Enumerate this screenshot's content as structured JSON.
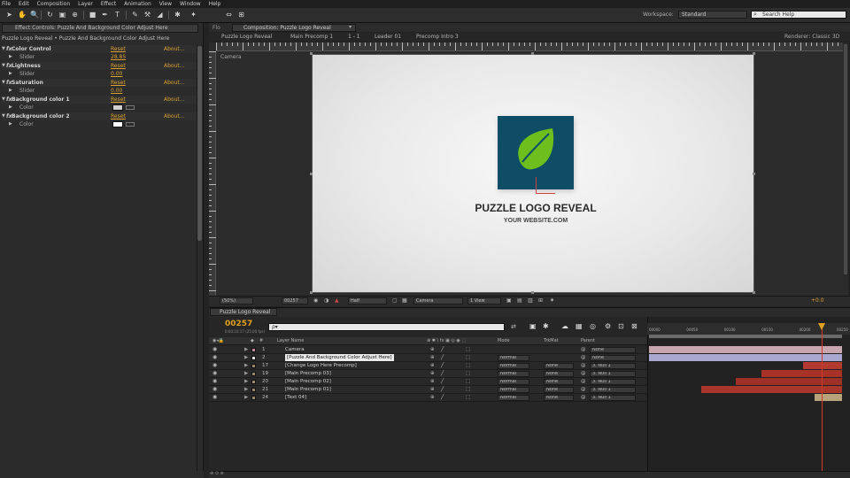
{
  "menu": [
    "File",
    "Edit",
    "Composition",
    "Layer",
    "Effect",
    "Animation",
    "View",
    "Window",
    "Help"
  ],
  "toolbar": {
    "workspace_label": "Workspace:",
    "workspace_value": "Standard",
    "search_placeholder": "Search Help"
  },
  "effect_controls": {
    "tab_label": "Effect Controls: Puzzle And Background Color Adjust Here",
    "breadcrumb": "Puzzle Logo Reveal • Puzzle And Background Color Adjust Here",
    "reset_label": "Reset",
    "about_label": "About...",
    "effects": [
      {
        "name": "Color Control",
        "sub": "Slider",
        "value": "28.85"
      },
      {
        "name": "Lightness",
        "sub": "Slider",
        "value": "0.00"
      },
      {
        "name": "Saturation",
        "sub": "Slider",
        "value": "0.00"
      },
      {
        "name": "Background color 1",
        "sub": "Color",
        "swatch": "#d0d0d0"
      },
      {
        "name": "Background color 2",
        "sub": "Color",
        "swatch": "#ffffff"
      }
    ]
  },
  "composition": {
    "tab_label": "Composition: Puzzle Logo Reveal",
    "flowchart_label": "Flo",
    "subtabs": [
      "Puzzle Logo Reveal",
      "Main Precomp 1",
      "1 - 1",
      "Leader 01",
      "Precomp Intro 3"
    ],
    "renderer": "Renderer: Classic 3D",
    "view_label": "Camera",
    "logo_title": "PUZZLE LOGO REVEAL",
    "logo_subtitle": "YOUR WEBSITE.COM",
    "brand_color": "#0f4c66",
    "leaf_color": "#6cbf1c"
  },
  "viewer_controls": {
    "zoom": "(50%)",
    "timecode": "00257",
    "resolution": "Half",
    "view": "Camera",
    "views": "1 View",
    "offset": "+0.0"
  },
  "timeline": {
    "tab_label": "Puzzle Logo Reveal",
    "current_time": "00257",
    "time_sub": "0:00:10:17 (25.00 fps)",
    "search_placeholder": "ρ▾",
    "columns": {
      "layer_name": "Layer Name",
      "mode": "Mode",
      "trkmat": "TrkMat",
      "parent": "Parent"
    },
    "ticks": [
      "00000",
      "00050",
      "00100",
      "00150",
      "00200",
      "00250"
    ],
    "layers": [
      {
        "num": "1",
        "name": "Camera",
        "mode": "",
        "trkmat": "",
        "parent": "None",
        "label": "#c48a9a",
        "selected": false
      },
      {
        "num": "2",
        "name": "[Puzzle And Background Color Adjust Here]",
        "mode": "Normal",
        "trkmat": "",
        "parent": "None",
        "label": "#e0e0e0",
        "selected": true
      },
      {
        "num": "17",
        "name": "[Change Logo Here Precomp]",
        "mode": "Normal",
        "trkmat": "None",
        "parent": "3. Null 1",
        "label": "#9a8a6a",
        "selected": false
      },
      {
        "num": "19",
        "name": "[Main Precomp 03]",
        "mode": "Normal",
        "trkmat": "None",
        "parent": "3. Null 1",
        "label": "#9a8a6a",
        "selected": false
      },
      {
        "num": "20",
        "name": "[Main Precomp 02]",
        "mode": "Normal",
        "trkmat": "None",
        "parent": "3. Null 1",
        "label": "#9a8a6a",
        "selected": false
      },
      {
        "num": "21",
        "name": "[Main Precomp 01]",
        "mode": "Normal",
        "trkmat": "None",
        "parent": "3. Null 1",
        "label": "#9a8a6a",
        "selected": false
      },
      {
        "num": "24",
        "name": "[Text 04]",
        "mode": "Normal",
        "trkmat": "None",
        "parent": "3. Null 1",
        "label": "#9a8a6a",
        "selected": false
      }
    ],
    "bars": [
      {
        "start": 0,
        "end": 257,
        "color": "#c9a6ae"
      },
      {
        "start": 0,
        "end": 257,
        "color": "#a8a8d0"
      },
      {
        "start": 205,
        "end": 257,
        "color": "#b23a30"
      },
      {
        "start": 150,
        "end": 257,
        "color": "#a83228"
      },
      {
        "start": 115,
        "end": 257,
        "color": "#9e3026"
      },
      {
        "start": 70,
        "end": 257,
        "color": "#a8362a"
      },
      {
        "start": 220,
        "end": 257,
        "color": "#b8a27a"
      }
    ],
    "duration": 257
  }
}
